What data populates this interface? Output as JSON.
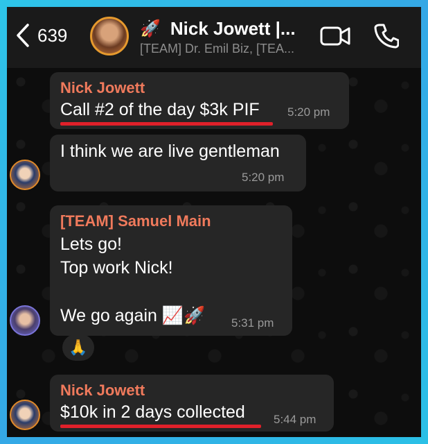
{
  "header": {
    "back_count": "639",
    "title": "Nick Jowett |...",
    "title_emoji": "🚀",
    "subtitle": "[TEAM] Dr. Emil Biz, [TEA..."
  },
  "messages": [
    {
      "sender": "Nick Jowett",
      "text": "Call #2 of the day $3k PIF",
      "time": "5:20 pm"
    },
    {
      "text": "I think we are live gentleman",
      "time": "5:20 pm"
    },
    {
      "sender": "[TEAM] Samuel Main",
      "lines": [
        "Lets go!",
        "Top work Nick!",
        "",
        "We go again 📈🚀"
      ],
      "time": "5:31 pm",
      "reaction": "🙏"
    },
    {
      "sender": "Nick Jowett",
      "text": "$10k in 2 days collected",
      "time": "5:44 pm"
    }
  ],
  "colors": {
    "sender": "#f07a5c",
    "underline": "#e0202a",
    "bubble": "#262626"
  }
}
